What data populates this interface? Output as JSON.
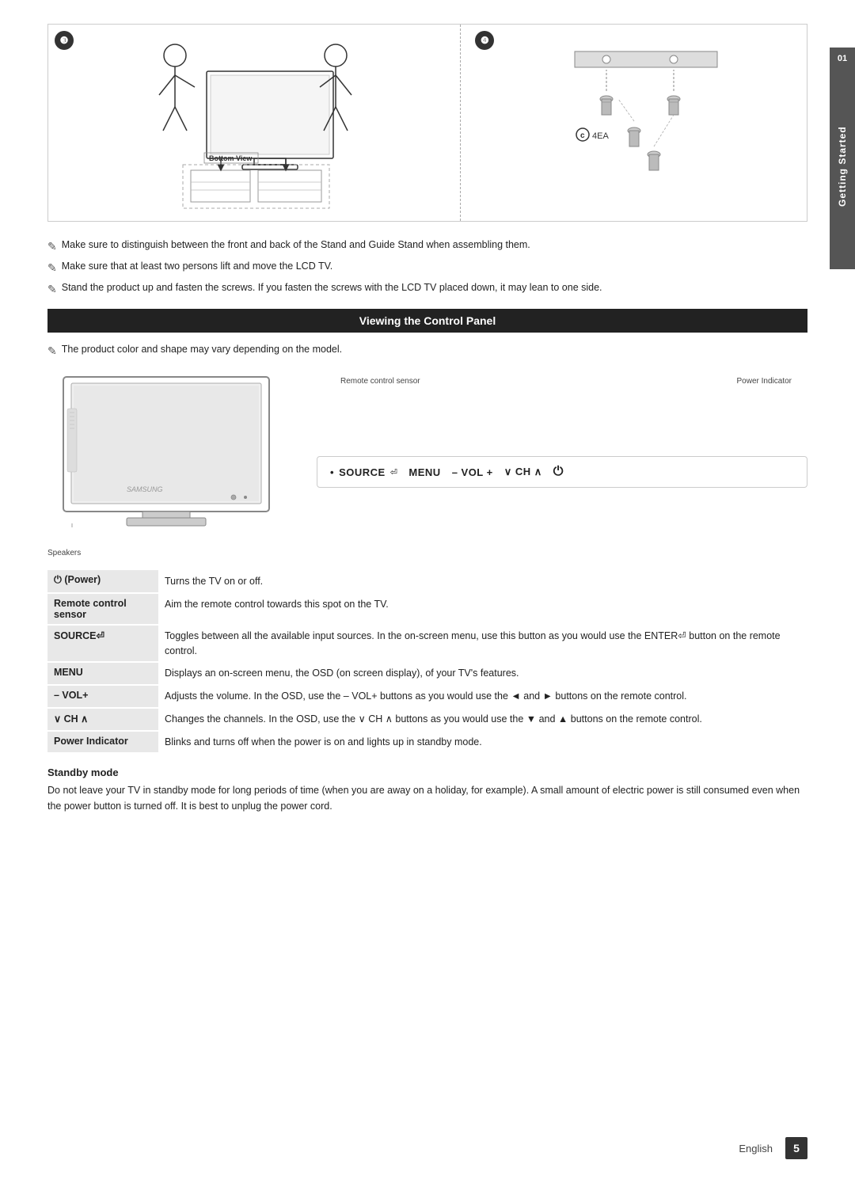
{
  "sidetab": {
    "number": "01",
    "text": "Getting Started"
  },
  "steps": {
    "step3": "❸",
    "step4": "❹"
  },
  "bottom_view": "Bottom View",
  "c_label": "C",
  "ea_label": "4EA",
  "notes": [
    "Make sure to distinguish between the front and back of the Stand and Guide Stand when assembling them.",
    "Make sure that at least two persons lift and move the LCD TV.",
    "Stand the product up and fasten the screws. If you fasten the screws with the LCD TV placed down, it may lean to one side."
  ],
  "section_header": "Viewing the Control Panel",
  "color_note": "The product color and shape may vary depending on the model.",
  "labels": {
    "remote_sensor": "Remote control sensor",
    "power_indicator_label": "Power Indicator",
    "speakers": "Speakers",
    "control_dot": "•",
    "source": "SOURCE",
    "source_icon": "⏎",
    "menu": "MENU",
    "vol": "– VOL +",
    "ch": "∨ CH ∧",
    "power_symbol": "⏻"
  },
  "features": [
    {
      "name": "⏻ (Power)",
      "description": "Turns the TV on or off."
    },
    {
      "name": "Remote control sensor",
      "description": "Aim the remote control towards this spot on the TV."
    },
    {
      "name": "SOURCE⏎",
      "description": "Toggles between all the available input sources. In the on-screen menu, use this button as you would use the ENTER⏎ button on the remote control."
    },
    {
      "name": "MENU",
      "description": "Displays an on-screen menu, the OSD (on screen display), of your TV's features."
    },
    {
      "name": "– VOL+",
      "description": "Adjusts the volume. In the OSD, use the – VOL+ buttons as you would use the ◄ and ► buttons on the remote control."
    },
    {
      "name": "∨ CH ∧",
      "description": "Changes the channels. In the OSD, use the ∨ CH ∧ buttons as you would use the ▼ and ▲ buttons on the remote control."
    },
    {
      "name": "Power Indicator",
      "description": "Blinks and turns off when the power is on and lights up in standby mode."
    }
  ],
  "standby": {
    "title": "Standby mode",
    "text": "Do not leave your TV in standby mode for long periods of time (when you are away on a holiday, for example). A small amount of electric power is still consumed even when the power button is turned off. It is best to unplug the power cord."
  },
  "footer": {
    "language": "English",
    "page": "5"
  }
}
